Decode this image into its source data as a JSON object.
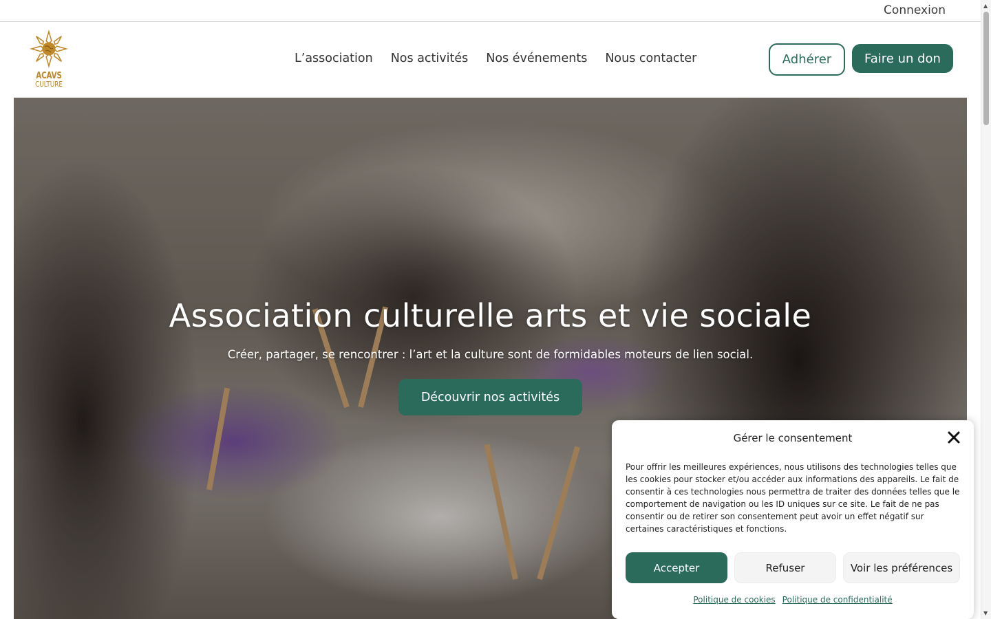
{
  "topbar": {
    "login": "Connexion"
  },
  "brand": {
    "line1": "ACAVS",
    "line2": "CULTURE",
    "logo_icon": "sun-globe-logo",
    "color": "#c0892a"
  },
  "nav": {
    "items": [
      {
        "label": "L’association"
      },
      {
        "label": "Nos activités"
      },
      {
        "label": "Nos événements"
      },
      {
        "label": "Nous contacter"
      }
    ]
  },
  "header_buttons": {
    "join": "Adhérer",
    "donate": "Faire un don"
  },
  "hero": {
    "title": "Association culturelle arts et vie sociale",
    "subtitle": "Créer, partager, se rencontrer : l’art et la culture sont de formidables moteurs de lien social.",
    "cta": "Découvrir nos activités"
  },
  "consent": {
    "title": "Gérer le consentement",
    "body": "Pour offrir les meilleures expériences, nous utilisons des technologies telles que les cookies pour stocker et/ou accéder aux informations des appareils. Le fait de consentir à ces technologies nous permettra de traiter des données telles que le comportement de navigation ou les ID uniques sur ce site. Le fait de ne pas consentir ou de retirer son consentement peut avoir un effet négatif sur certaines caractéristiques et fonctions.",
    "accept": "Accepter",
    "refuse": "Refuser",
    "preferences": "Voir les préférences",
    "cookie_policy": "Politique de cookies",
    "privacy_policy": "Politique de confidentialité",
    "close_icon": "close-icon"
  },
  "colors": {
    "primary": "#2a6b5c",
    "brand_gold": "#c0892a"
  }
}
